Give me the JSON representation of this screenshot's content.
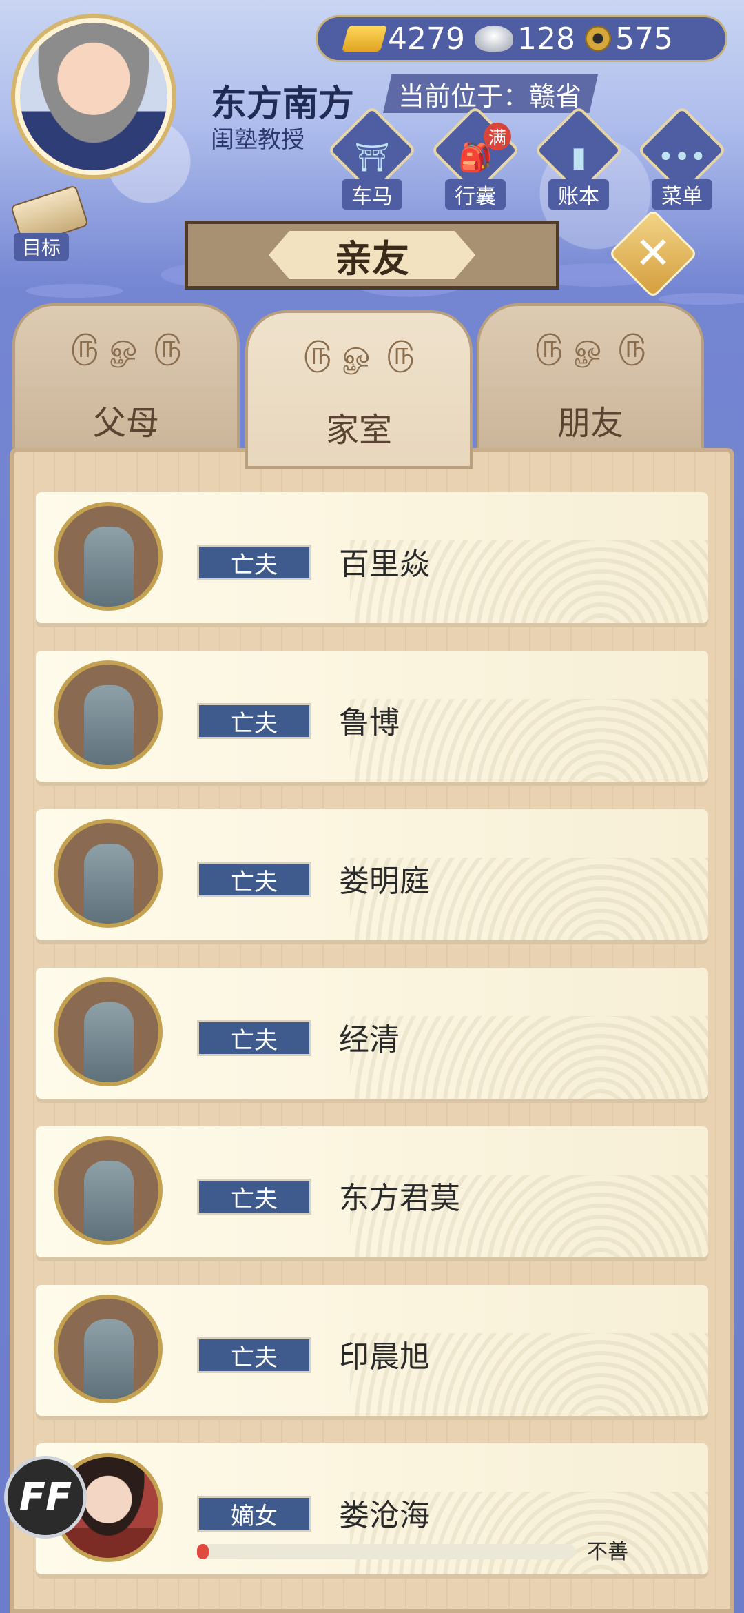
{
  "currency": {
    "gold": "4279",
    "silver": "128",
    "coins": "575",
    "icons": [
      "gold-ingot-icon",
      "silver-ingot-icon",
      "copper-coin-icon"
    ]
  },
  "player": {
    "name": "东方南方",
    "title": "闺塾教授",
    "location_label": "当前位于：赣省"
  },
  "nav": [
    {
      "label": "车马",
      "icon": "carriage-icon"
    },
    {
      "label": "行囊",
      "icon": "bag-icon",
      "badge": "满"
    },
    {
      "label": "账本",
      "icon": "ledger-icon"
    },
    {
      "label": "菜单",
      "icon": "more-icon"
    }
  ],
  "goal_label": "目标",
  "page_title": "亲友",
  "tabs": [
    "父母",
    "家室",
    "朋友"
  ],
  "active_tab": "家室",
  "relatives": [
    {
      "tag": "亡夫",
      "name": "百里焱",
      "portrait": "tombstone"
    },
    {
      "tag": "亡夫",
      "name": "鲁博",
      "portrait": "tombstone"
    },
    {
      "tag": "亡夫",
      "name": "娄明庭",
      "portrait": "tombstone"
    },
    {
      "tag": "亡夫",
      "name": "经清",
      "portrait": "tombstone"
    },
    {
      "tag": "亡夫",
      "name": "东方君莫",
      "portrait": "tombstone"
    },
    {
      "tag": "亡夫",
      "name": "印晨旭",
      "portrait": "tombstone"
    },
    {
      "tag": "嫡女",
      "name": "娄沧海",
      "portrait": "daughter",
      "relation_label": "不善",
      "relation_level": 0.03
    }
  ],
  "ff_button": "FF",
  "colors": {
    "accent": "#4f5ea3",
    "tag_bg": "#3f5a8c",
    "bar_fill": "#e04a3e"
  }
}
